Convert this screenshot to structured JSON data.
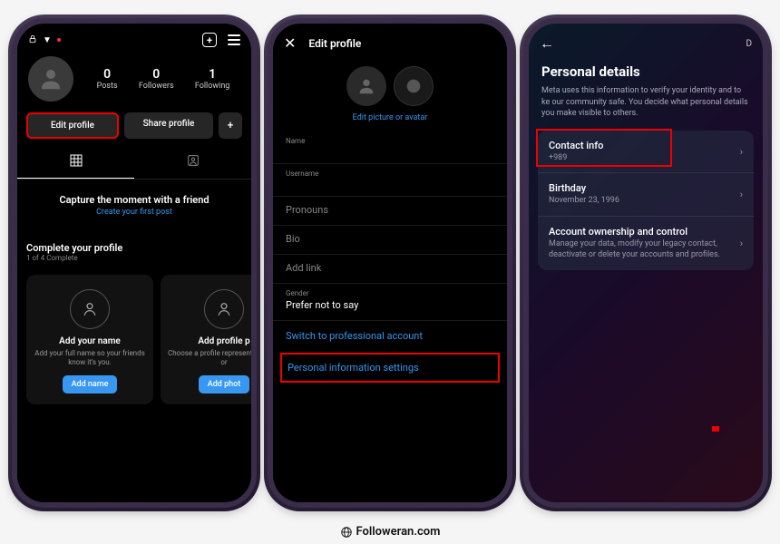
{
  "phone1": {
    "username_chevron": "▼",
    "stats": [
      {
        "num": "0",
        "label": "Posts"
      },
      {
        "num": "0",
        "label": "Followers"
      },
      {
        "num": "1",
        "label": "Following"
      }
    ],
    "edit_btn": "Edit profile",
    "share_btn": "Share profile",
    "capture_title": "Capture the moment with a friend",
    "capture_link": "Create your first post",
    "complete_title": "Complete your profile",
    "complete_sub": "1 of 4 Complete",
    "cards": [
      {
        "title": "Add your name",
        "desc": "Add your full name so your friends know it's you.",
        "btn": "Add name"
      },
      {
        "title": "Add profile p",
        "desc": "Choose a profile represent yourself or",
        "btn": "Add phot"
      }
    ]
  },
  "phone2": {
    "title": "Edit profile",
    "edit_link": "Edit picture or avatar",
    "fields": {
      "name_label": "Name",
      "username_label": "Username",
      "pronouns_label": "Pronouns",
      "bio_label": "Bio",
      "addlink_label": "Add link",
      "gender_label": "Gender",
      "gender_value": "Prefer not to say"
    },
    "switch_link": "Switch to professional account",
    "personal_link": "Personal information settings"
  },
  "phone3": {
    "corner": "D",
    "title": "Personal details",
    "desc": "Meta uses this information to verify your identity and to ke our community safe. You decide what personal details you make visible to others.",
    "items": [
      {
        "title": "Contact info",
        "sub": "+989"
      },
      {
        "title": "Birthday",
        "sub": "November 23, 1996"
      },
      {
        "title": "Account ownership and control",
        "sub": "Manage your data, modify your legacy contact, deactivate or delete your accounts and profiles."
      }
    ]
  },
  "footer": "Followeran.com"
}
